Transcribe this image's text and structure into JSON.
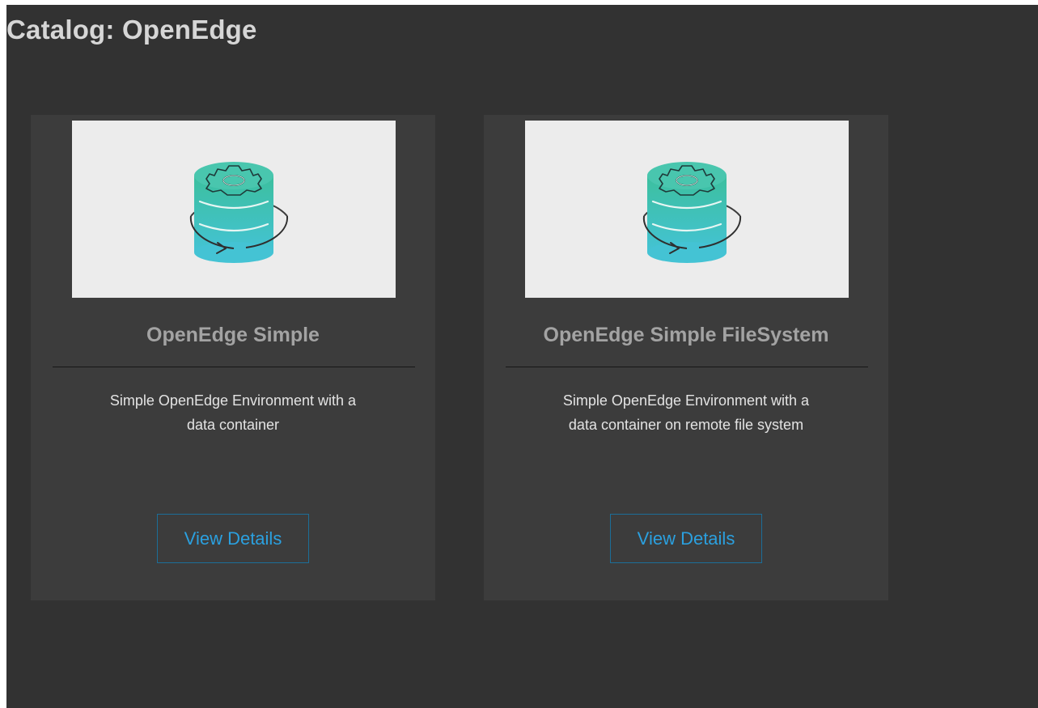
{
  "page": {
    "title": "Catalog: OpenEdge"
  },
  "cards": [
    {
      "title": "OpenEdge Simple",
      "description_line1": "Simple OpenEdge Environment with a",
      "description_line2": "data container",
      "button_label": "View Details",
      "image_icon": "database-gear-sync-icon"
    },
    {
      "title": "OpenEdge Simple FileSystem",
      "description_line1": "Simple OpenEdge Environment with a",
      "description_line2": "data container on remote file system",
      "button_label": "View Details",
      "image_icon": "database-gear-sync-icon"
    }
  ],
  "colors": {
    "background": "#323232",
    "card_background": "#3c3c3c",
    "accent": "#2ba0df",
    "icon_teal": "#3dbfb3"
  }
}
